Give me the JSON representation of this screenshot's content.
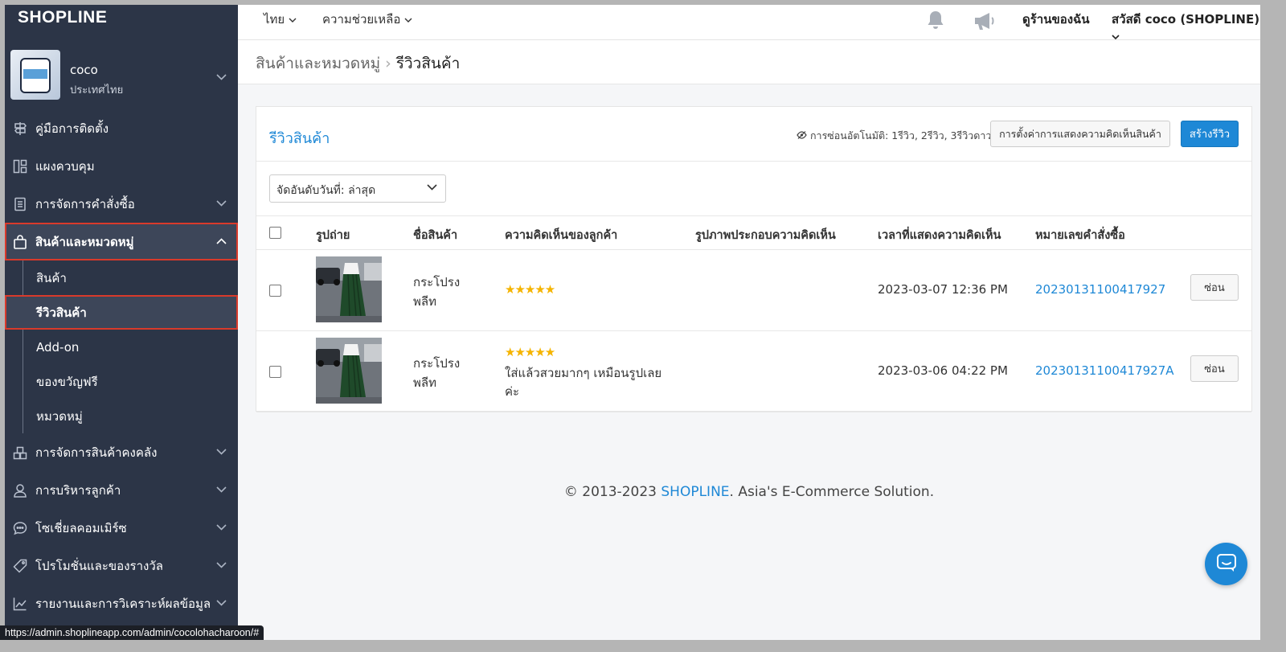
{
  "brand": {
    "logo": "SHOPLINE"
  },
  "store": {
    "name": "coco",
    "country": "ประเทศไทย"
  },
  "sidebar": {
    "items": [
      {
        "label": "คู่มือการติดตั้ง",
        "icon": "signpost-icon"
      },
      {
        "label": "แผงควบคุม",
        "icon": "dashboard-icon"
      },
      {
        "label": "การจัดการคำสั่งซื้อ",
        "icon": "clipboard-icon"
      },
      {
        "label": "สินค้าและหมวดหมู่",
        "icon": "bag-icon"
      },
      {
        "label": "การจัดการสินค้าคงคลัง",
        "icon": "warehouse-icon"
      },
      {
        "label": "การบริหารลูกค้า",
        "icon": "user-icon"
      },
      {
        "label": "โซเชี่ยลคอมเมิร์ซ",
        "icon": "chat-bubble-icon"
      },
      {
        "label": "โปรโมชั่นและของรางวัล",
        "icon": "tag-icon"
      },
      {
        "label": "รายงานและการวิเคราะห์ผลข้อมูล",
        "icon": "chart-icon"
      }
    ],
    "sub_items": [
      {
        "label": "สินค้า"
      },
      {
        "label": "รีวิวสินค้า"
      },
      {
        "label": "Add-on"
      },
      {
        "label": "ของขวัญฟรี"
      },
      {
        "label": "หมวดหมู่"
      }
    ]
  },
  "status_bar": {
    "url": "https://admin.shoplineapp.com/admin/cocolohacharoon/#"
  },
  "topbar": {
    "language": "ไทย",
    "help": "ความช่วยเหลือ",
    "my_store": "ดูร้านของฉัน",
    "greeting": "สวัสดี coco (SHOPLINE)"
  },
  "breadcrumb": {
    "parent": "สินค้าและหมวดหมู่",
    "current": "รีวิวสินค้า"
  },
  "card": {
    "title": "รีวิวสินค้า",
    "auto_hide": "การซ่อนอัตโนมัติ: 1รีวิว, 2รีวิว, 3รีวิวดาว",
    "settings_button": "การตั้งค่าการแสดงความคิดเห็นสินค้า",
    "create_button": "สร้างรีวิว",
    "sort_label": "จัดอันดับวันที่: ล่าสุด"
  },
  "table": {
    "headers": {
      "photo": "รูปถ่าย",
      "product": "ชื่อสินค้า",
      "comment": "ความคิดเห็นของลูกค้า",
      "images": "รูปภาพประกอบความคิดเห็น",
      "time": "เวลาที่แสดงความคิดเห็น",
      "order": "หมายเลขคำสั่งซื้อ"
    },
    "rows": [
      {
        "product_line1": "กระโปรง",
        "product_line2": "พลีท",
        "stars": "★★★★★",
        "rating": 5,
        "comment_line1": "",
        "comment_line2": "",
        "time": "2023-03-07 12:36 PM",
        "order": "20230131100417927",
        "hide_button": "ซ่อน"
      },
      {
        "product_line1": "กระโปรง",
        "product_line2": "พลีท",
        "stars": "★★★★★",
        "rating": 5,
        "comment_line1": "ใส่แล้วสวยมากๆ เหมือนรูปเลย",
        "comment_line2": "ค่ะ",
        "time": "2023-03-06 04:22 PM",
        "order": "20230131100417927A",
        "hide_button": "ซ่อน"
      }
    ]
  },
  "footer": {
    "prefix": "© 2013-2023 ",
    "brand": "SHOPLINE",
    "suffix": ". Asia's E-Commerce Solution."
  },
  "colors": {
    "sidebar_bg": "#2c3547",
    "accent": "#1e88d6",
    "highlight": "#d93a2b",
    "star": "#f5b400"
  }
}
